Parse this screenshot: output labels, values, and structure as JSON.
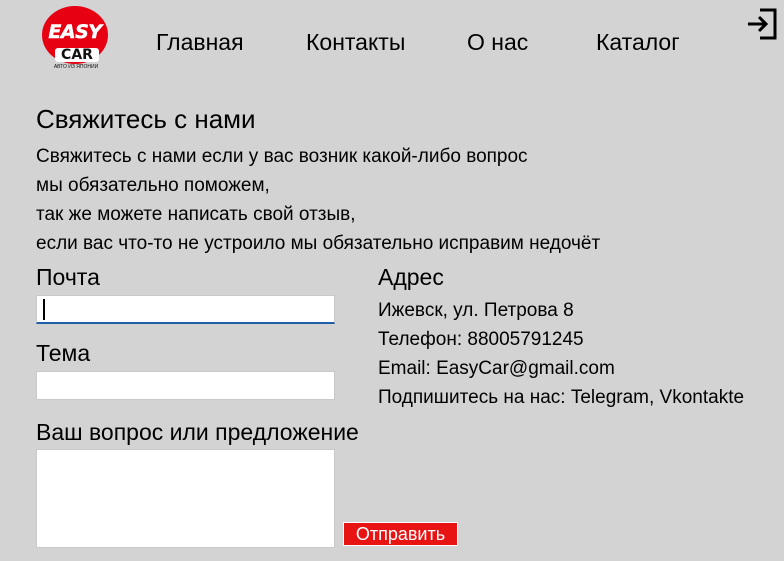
{
  "logo": {
    "brand_top": "EASY",
    "brand_bottom": "CAR",
    "tagline": "АВТО ИЗ ЯПОНИИ",
    "accent_color": "#e60012"
  },
  "nav": {
    "home": "Главная",
    "contacts": "Контакты",
    "about": "О нас",
    "catalog": "Каталог",
    "login_icon": "login-icon"
  },
  "intro": {
    "heading": "Свяжитесь с нами",
    "lines": [
      "Свяжитесь с нами если у вас возник какой-либо вопрос",
      "мы обязательно поможем,",
      "так же можете написать свой отзыв,",
      "если вас что-то не устроило мы обязательно исправим недочёт"
    ]
  },
  "form": {
    "email_label": "Почта",
    "email_value": "",
    "topic_label": "Тема",
    "topic_value": "",
    "message_label": "Ваш вопрос или предложение",
    "message_value": "",
    "submit_label": "Отправить",
    "submit_color": "#e81414"
  },
  "address": {
    "heading": "Адрес",
    "street": "Ижевск, ул. Петрова 8",
    "phone": "Телефон: 88005791245",
    "email": "Email: EasyCar@gmail.com",
    "subscribe_label": "Подпишитесь на нас:",
    "telegram": "Telegram,",
    "vkontakte": "Vkontakte"
  }
}
